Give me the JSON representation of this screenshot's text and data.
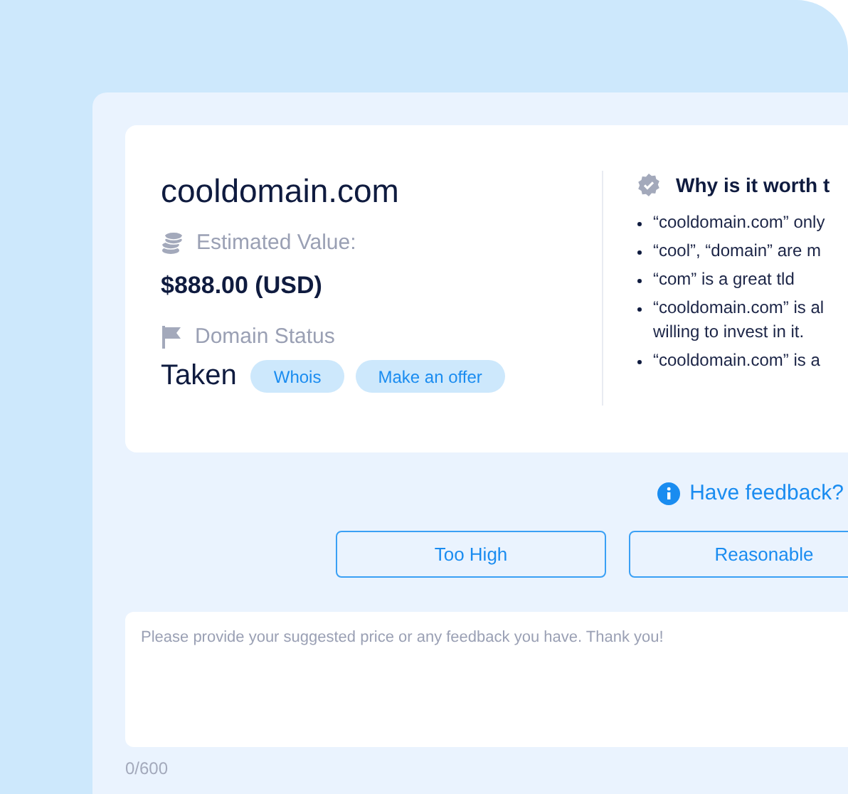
{
  "domain": "cooldomain.com",
  "estimate": {
    "label": "Estimated Value:",
    "value": "$888.00 (USD)"
  },
  "status": {
    "label": "Domain Status",
    "value": "Taken",
    "actions": [
      "Whois",
      "Make an offer"
    ]
  },
  "why": {
    "title": "Why is it worth t",
    "reasons": [
      {
        "lines": [
          "“cooldomain.com” only"
        ]
      },
      {
        "lines": [
          "“cool”, “domain” are m"
        ]
      },
      {
        "lines": [
          "“com” is a great tld"
        ]
      },
      {
        "lines": [
          "“cooldomain.com” is al",
          "willing to invest in it."
        ]
      },
      {
        "lines": [
          "“cooldomain.com” is a"
        ]
      }
    ]
  },
  "feedback": {
    "link": "Have feedback?",
    "ratings": [
      "Too High",
      "Reasonable"
    ],
    "placeholder": "Please provide your suggested price or any feedback you have. Thank you!",
    "counter": "0/600"
  }
}
